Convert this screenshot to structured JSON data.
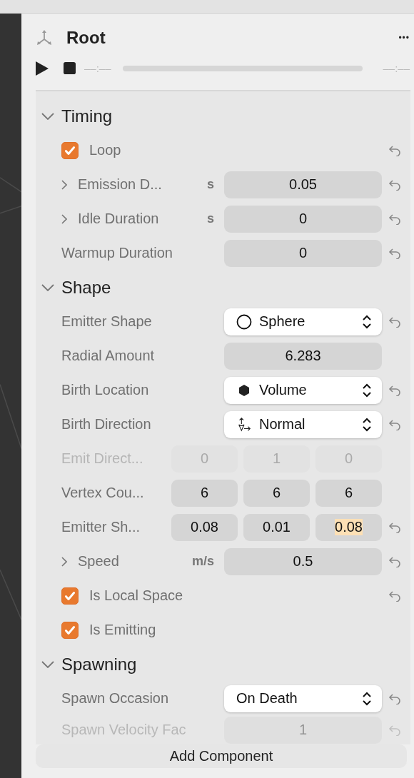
{
  "header": {
    "title": "Root",
    "more": "•••"
  },
  "transport": {
    "start_time": "––:––",
    "end_time": "––:––",
    "level": 0
  },
  "sections": [
    {
      "title": "Timing",
      "expanded": true,
      "rows": [
        {
          "kind": "checkbox",
          "label": "Loop",
          "checked": true,
          "reset": true
        },
        {
          "kind": "number",
          "label": "Emission D...",
          "expandable": true,
          "unit": "s",
          "value": "0.05",
          "reset": true
        },
        {
          "kind": "number",
          "label": "Idle Duration",
          "expandable": true,
          "unit": "s",
          "value": "0",
          "reset": true
        },
        {
          "kind": "number",
          "label": "Warmup Duration",
          "expandable": false,
          "value": "0",
          "reset": true
        }
      ]
    },
    {
      "title": "Shape",
      "expanded": true,
      "rows": [
        {
          "kind": "select",
          "label": "Emitter Shape",
          "value": "Sphere",
          "reset": true
        },
        {
          "kind": "number",
          "label": "Radial Amount",
          "expandable": false,
          "value": "6.283",
          "reset": false
        },
        {
          "kind": "select",
          "label": "Birth Location",
          "value": "Volume",
          "reset": true
        },
        {
          "kind": "select",
          "label": "Birth Direction",
          "value": "Normal",
          "reset": true
        },
        {
          "kind": "vector",
          "label": "Emit Direct...",
          "disabled": true,
          "values": [
            {
              "value": "0",
              "selected": false
            },
            {
              "value": "1",
              "selected": false
            },
            {
              "value": "0",
              "selected": false
            }
          ],
          "reset": false
        },
        {
          "kind": "vector",
          "label": "Vertex Cou...",
          "disabled": false,
          "values": [
            {
              "value": "6",
              "selected": false
            },
            {
              "value": "6",
              "selected": false
            },
            {
              "value": "6",
              "selected": false
            }
          ],
          "reset": false
        },
        {
          "kind": "vector",
          "label": "Emitter Sh...",
          "disabled": false,
          "values": [
            {
              "value": "0.08",
              "selected": false
            },
            {
              "value": "0.01",
              "selected": false
            },
            {
              "value": "0.08",
              "selected": true
            }
          ],
          "reset": true
        },
        {
          "kind": "number",
          "label": "Speed",
          "expandable": true,
          "unit": "m/s",
          "value": "0.5",
          "reset": true
        },
        {
          "kind": "checkbox",
          "label": "Is Local Space",
          "checked": true,
          "reset": true
        },
        {
          "kind": "checkbox",
          "label": "Is Emitting",
          "checked": true,
          "reset": false
        }
      ]
    },
    {
      "title": "Spawning",
      "expanded": true,
      "rows": [
        {
          "kind": "select",
          "label": "Spawn Occasion",
          "value": "On Death",
          "reset": true
        },
        {
          "kind": "number",
          "label": "Spawn Velocity Fac",
          "expandable": false,
          "value": "1",
          "reset": true,
          "faded": true
        }
      ]
    }
  ],
  "add_button": "Add Component"
}
